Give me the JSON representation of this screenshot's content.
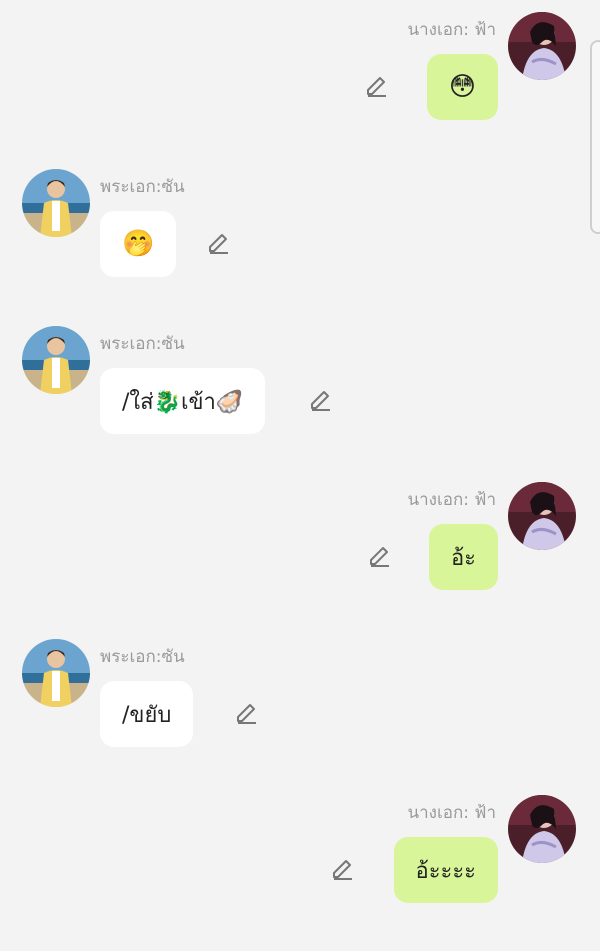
{
  "messages": [
    {
      "side": "right",
      "sender": "นางเอก: ฟ้า",
      "text": "😳"
    },
    {
      "side": "left",
      "sender": "พระเอก:ซัน",
      "text": "🤭"
    },
    {
      "side": "left",
      "sender": "พระเอก:ซัน",
      "text": "/ใส่🐉เข้า🦪"
    },
    {
      "side": "right",
      "sender": "นางเอก: ฟ้า",
      "text": "อ้ะ"
    },
    {
      "side": "left",
      "sender": "พระเอก:ซัน",
      "text": "/ขยับ"
    },
    {
      "side": "right",
      "sender": "นางเอก: ฟ้า",
      "text": "อ้ะะะะ"
    }
  ],
  "colors": {
    "background": "#f3f3f3",
    "right_bubble": "#d9f59a",
    "left_bubble": "#ffffff",
    "sender_text": "#9a9a9a"
  },
  "icons": {
    "edit": "pencil-icon"
  }
}
